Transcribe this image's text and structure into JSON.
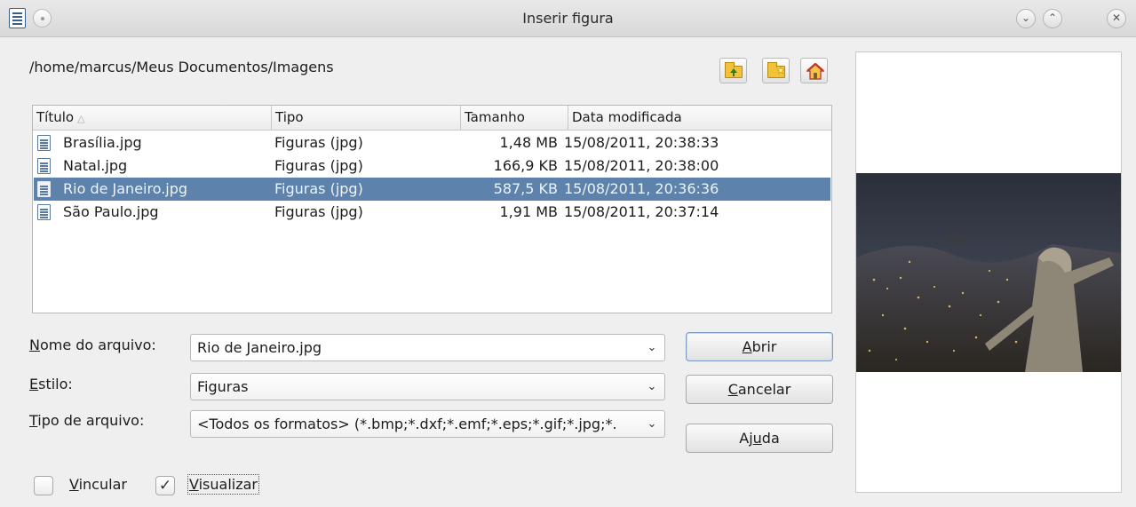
{
  "window": {
    "title": "Inserir figura",
    "controls": [
      "minimize",
      "maximize",
      "close"
    ]
  },
  "path": "/home/marcus/Meus Documentos/Imagens",
  "toolbar": {
    "icons": [
      "folder-up-icon",
      "new-folder-icon",
      "home-icon"
    ]
  },
  "file_list": {
    "columns": [
      "Título",
      "Tipo",
      "Tamanho",
      "Data modificada"
    ],
    "rows": [
      {
        "name": "Brasília.jpg",
        "type": "Figuras (jpg)",
        "size": "1,48 MB",
        "date": "15/08/2011, 20:38:33",
        "selected": false
      },
      {
        "name": "Natal.jpg",
        "type": "Figuras (jpg)",
        "size": "166,9 KB",
        "date": "15/08/2011, 20:38:00",
        "selected": false
      },
      {
        "name": "Rio de Janeiro.jpg",
        "type": "Figuras (jpg)",
        "size": "587,5 KB",
        "date": "15/08/2011, 20:36:36",
        "selected": true
      },
      {
        "name": "São Paulo.jpg",
        "type": "Figuras (jpg)",
        "size": "1,91 MB",
        "date": "15/08/2011, 20:37:14",
        "selected": false
      }
    ]
  },
  "form": {
    "filename_label_key": "N",
    "filename_label_rest": "ome do arquivo:",
    "filename_value": "Rio de Janeiro.jpg",
    "style_label_key": "E",
    "style_label_rest": "stilo:",
    "style_value": "Figuras",
    "filetype_label_key": "T",
    "filetype_label_rest": "ipo de arquivo:",
    "filetype_value": "<Todos os formatos> (*.bmp;*.dxf;*.emf;*.eps;*.gif;*.jpg;*."
  },
  "buttons": {
    "open_key": "A",
    "open_rest": "brir",
    "cancel_key": "C",
    "cancel_rest": "ancelar",
    "help_pre": "Aj",
    "help_key": "u",
    "help_rest": "da"
  },
  "options": {
    "link_key": "V",
    "link_rest": "incular",
    "link_checked": false,
    "preview_key": "V",
    "preview_rest": "isualizar",
    "preview_checked": true
  },
  "colors": {
    "selection": "#5d82ab",
    "folder": "#f2c23a"
  }
}
